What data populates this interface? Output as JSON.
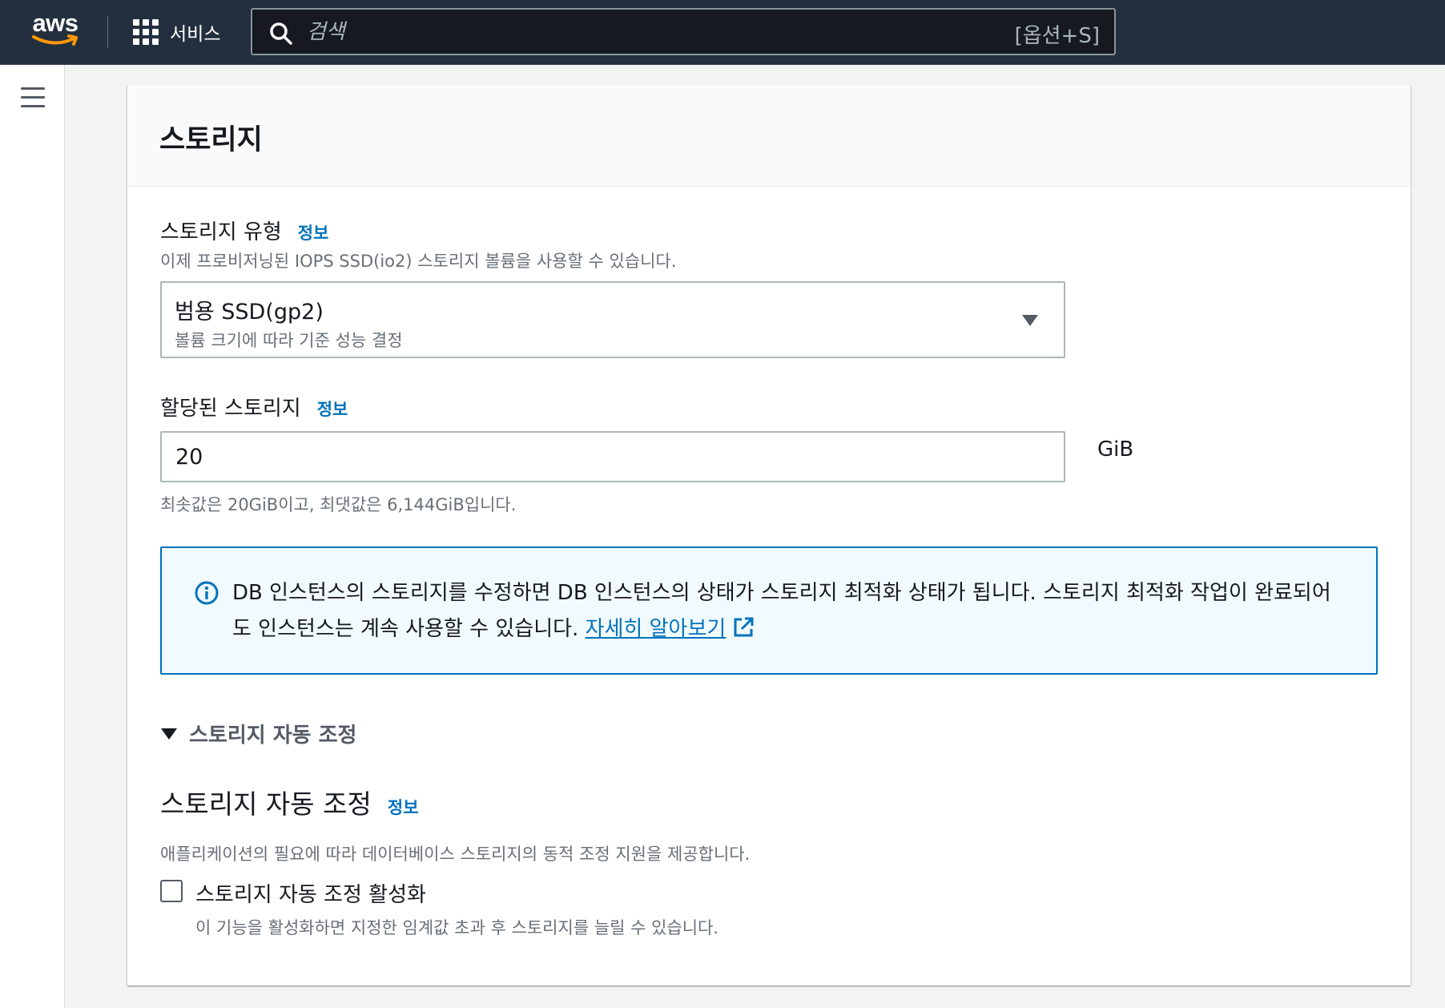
{
  "topnav": {
    "logo_text": "aws",
    "services_label": "서비스",
    "search_placeholder": "검색",
    "search_shortcut": "[옵션+S]"
  },
  "storage": {
    "title": "스토리지",
    "type_label": "스토리지 유형",
    "info_link": "정보",
    "type_description": "이제 프로비저닝된 IOPS SSD(io2) 스토리지 볼륨을 사용할 수 있습니다.",
    "type_selected": "범용 SSD(gp2)",
    "type_selected_sub": "볼륨 크기에 따라 기준 성능 결정",
    "allocated_label": "할당된 스토리지",
    "allocated_value": "20",
    "unit": "GiB",
    "allocated_constraint": "최솟값은 20GiB이고, 최댓값은 6,144GiB입니다.",
    "alert_text": "DB 인스턴스의 스토리지를 수정하면 DB 인스턴스의 상태가 스토리지 최적화 상태가 됩니다. 스토리지 최적화 작업이 완료되어도 인스턴스는 계속 사용할 수 있습니다.",
    "alert_link": "자세히 알아보기"
  },
  "autoscaling": {
    "expander_label": "스토리지 자동 조정",
    "section_title": "스토리지 자동 조정",
    "info_link": "정보",
    "description": "애플리케이션의 필요에 따라 데이터베이스 스토리지의 동적 조정 지원을 제공합니다.",
    "checkbox_label": "스토리지 자동 조정 활성화",
    "checkbox_description": "이 기능을 활성화하면 지정한 임계값 초과 후 스토리지를 늘릴 수 있습니다.",
    "checked": false
  },
  "colors": {
    "nav_bg": "#232f3e",
    "link": "#0073bb",
    "alert_bg": "#f1faff",
    "smile": "#ff9900"
  }
}
